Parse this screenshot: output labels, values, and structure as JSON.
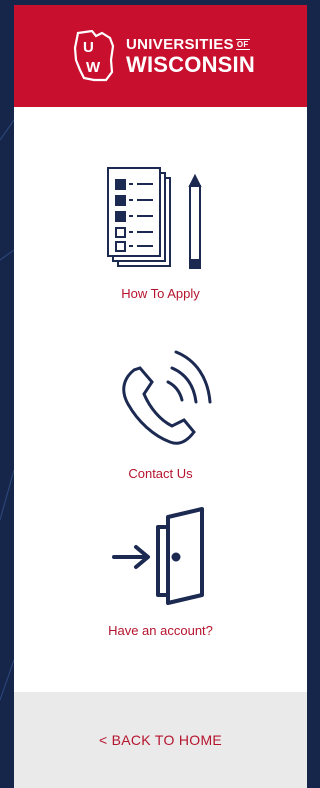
{
  "brand": {
    "line1": "UNIVERSITIES",
    "of_mark": "OF",
    "line2": "WISCONSIN",
    "crest_letters": "UW",
    "header_color": "#c8102e"
  },
  "menu": {
    "items": [
      {
        "label": "How To Apply",
        "icon": "checklist-icon"
      },
      {
        "label": "Contact Us",
        "icon": "phone-icon"
      },
      {
        "label": "Have an account?",
        "icon": "door-login-icon"
      }
    ],
    "label_color": "#b5142e",
    "icon_color": "#1c2a52"
  },
  "footer": {
    "back_label": "< BACK TO HOME"
  }
}
